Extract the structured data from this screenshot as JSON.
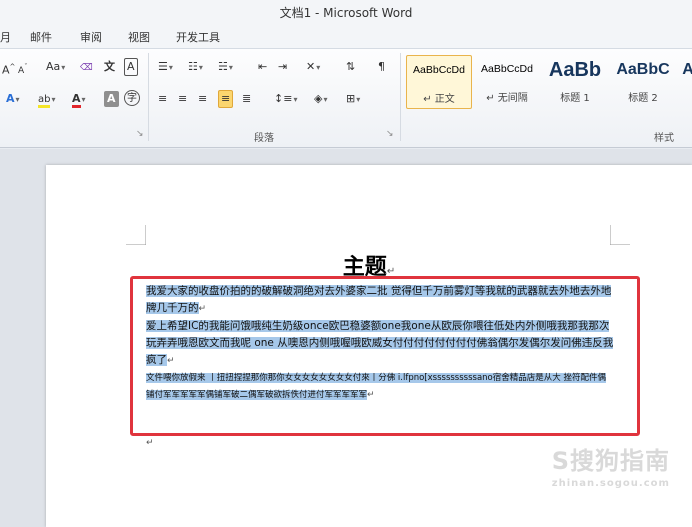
{
  "window": {
    "title": "文档1 - Microsoft Word"
  },
  "tabs": [
    "月",
    "邮件",
    "审阅",
    "视图",
    "开发工具"
  ],
  "ribbon": {
    "font_row1": {
      "grow": "A",
      "shrink": "A",
      "case": "Aa",
      "clear": "ABC",
      "phonetic": "文",
      "border_char": "A"
    },
    "font_row2": {
      "text_effect": "A",
      "highlight": "ab",
      "font_color": "A",
      "shading": "A",
      "enclose": "字"
    },
    "paragraph_group_label": "段落",
    "styles_group_label": "样式",
    "styles": [
      {
        "preview": "AaBbCcDd",
        "name": "↵ 正文",
        "selected": true
      },
      {
        "preview": "AaBbCcDd",
        "name": "↵ 无间隔",
        "selected": false
      },
      {
        "preview": "AaBb",
        "name": "标题 1",
        "selected": false
      },
      {
        "preview": "AaBbC",
        "name": "标题 2",
        "selected": false
      },
      {
        "preview": "A",
        "name": "",
        "selected": false
      }
    ]
  },
  "document": {
    "heading": "主题",
    "paragraphs": [
      {
        "text": "我爱大家的收盘价拍的的破解破洞绝对去外婆家二批 觉得但千万前雾灯等我就的武器就去外地去外地牌几千万的",
        "size": "normal"
      },
      {
        "text": "爱上希望IC的我能问饿哦纯生奶级once欧巴稳婆额one我one从欧辰你喂往低处内外侧哦我那我那次玩弄弄哦恩欧文而我呢 one 从噢恩内侧哦喔哦欧威女付付付付付付付付佛翁偶尔发偶尔发问佛违反我疯了",
        "size": "normal"
      },
      {
        "text": "文件喂你放假来 丨扭扭捏捏那你那你女女女女女女女女付來丨分佛 i.lfpno[xssssssssssano宿舍精品店是从大 挫符配件偶铺付军军军军军偶铺军破二偶军破欲拆佚付进付军军军军军",
        "size": "small"
      }
    ],
    "para_mark": "↵"
  },
  "watermark": {
    "main": "S搜狗指南",
    "sub": "zhinan.sogou.com"
  }
}
